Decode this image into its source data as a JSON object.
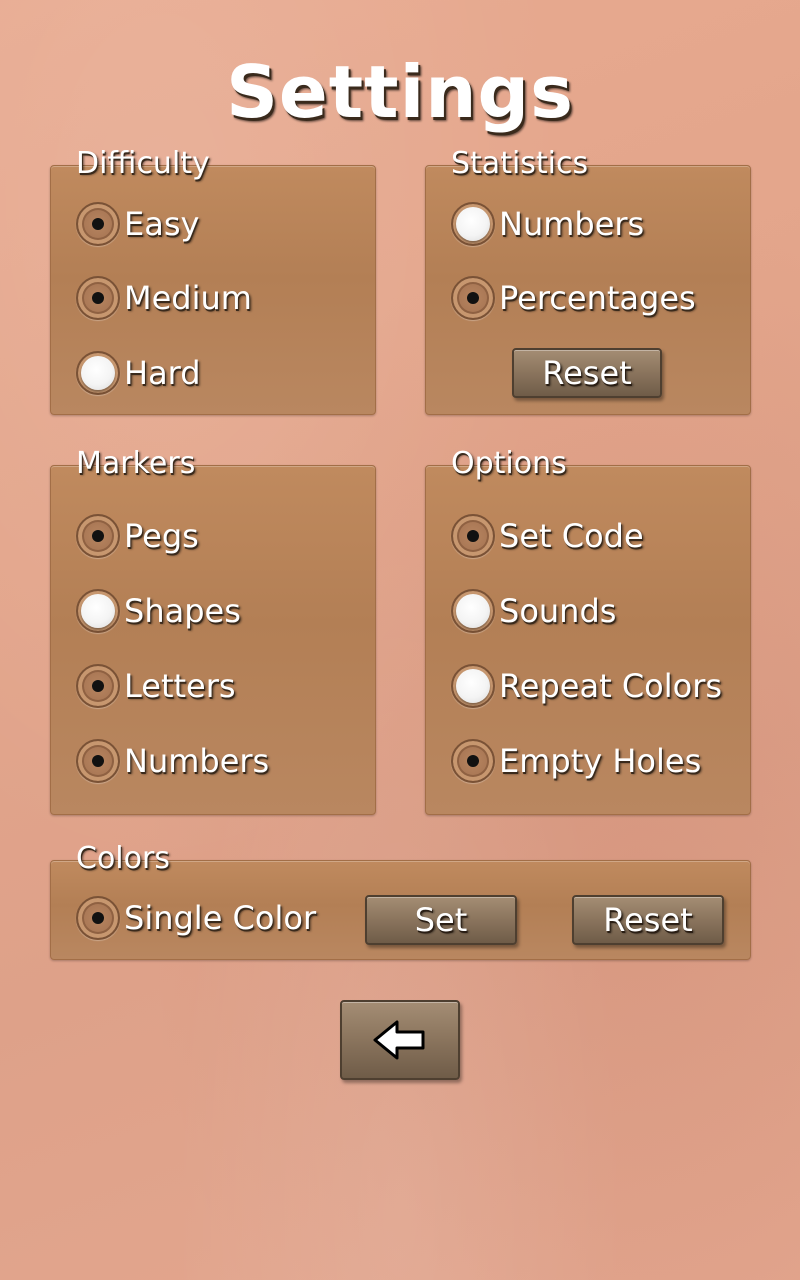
{
  "page": {
    "title": "Settings"
  },
  "difficulty": {
    "title": "Difficulty",
    "options": [
      {
        "label": "Easy",
        "selected": true
      },
      {
        "label": "Medium",
        "selected": true
      },
      {
        "label": "Hard",
        "selected": false
      }
    ]
  },
  "statistics": {
    "title": "Statistics",
    "options": [
      {
        "label": "Numbers",
        "selected": false
      },
      {
        "label": "Percentages",
        "selected": true
      }
    ],
    "reset_label": "Reset"
  },
  "markers": {
    "title": "Markers",
    "options": [
      {
        "label": "Pegs",
        "selected": true
      },
      {
        "label": "Shapes",
        "selected": false
      },
      {
        "label": "Letters",
        "selected": true
      },
      {
        "label": "Numbers",
        "selected": true
      }
    ]
  },
  "options": {
    "title": "Options",
    "options": [
      {
        "label": "Set Code",
        "selected": true
      },
      {
        "label": "Sounds",
        "selected": false
      },
      {
        "label": "Repeat Colors",
        "selected": false
      },
      {
        "label": "Empty Holes",
        "selected": true
      }
    ]
  },
  "colors": {
    "title": "Colors",
    "single_color": {
      "label": "Single Color",
      "selected": true
    },
    "set_label": "Set",
    "reset_label": "Reset"
  },
  "back": {
    "icon": "back-arrow-icon"
  }
}
